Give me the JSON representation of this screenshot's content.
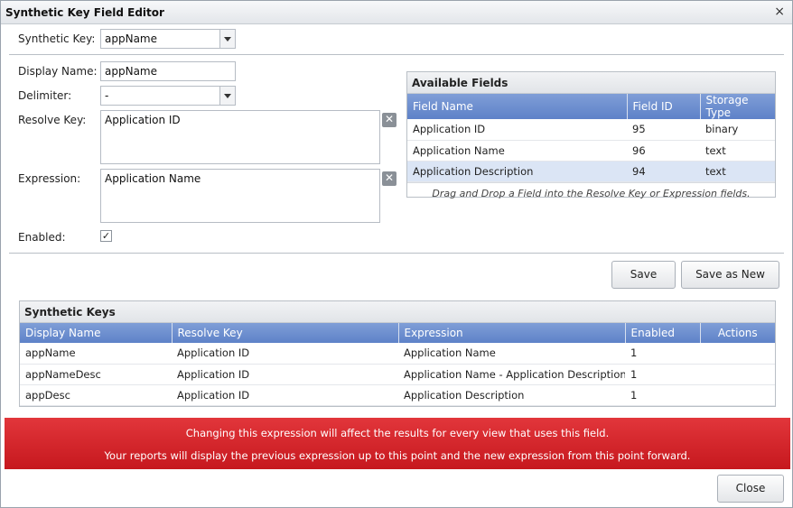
{
  "window": {
    "title": "Synthetic Key Field Editor",
    "close_glyph": "×"
  },
  "form": {
    "synthetic_key_label": "Synthetic Key:",
    "synthetic_key_value": "appName",
    "display_name_label": "Display Name:",
    "display_name_value": "appName",
    "delimiter_label": "Delimiter:",
    "delimiter_value": "-",
    "resolve_key_label": "Resolve Key:",
    "resolve_key_value": "Application ID",
    "expression_label": "Expression:",
    "expression_value": "Application Name",
    "enabled_label": "Enabled:",
    "enabled_check": "✓",
    "clear_glyph": "✕"
  },
  "available_fields": {
    "title": "Available Fields",
    "columns": [
      "Field Name",
      "Field ID",
      "Storage Type"
    ],
    "rows": [
      [
        "Application ID",
        "95",
        "binary"
      ],
      [
        "Application Name",
        "96",
        "text"
      ],
      [
        "Application Description",
        "94",
        "text"
      ]
    ],
    "hint": "Drag and Drop a Field into the Resolve Key or Expression fields."
  },
  "buttons": {
    "save": "Save",
    "save_as_new": "Save as New",
    "close": "Close"
  },
  "synthetic_keys": {
    "title": "Synthetic Keys",
    "columns": [
      "Display Name",
      "Resolve Key",
      "Expression",
      "Enabled",
      "Actions"
    ],
    "rows": [
      [
        "appName",
        "Application ID",
        "Application Name",
        "1",
        ""
      ],
      [
        "appNameDesc",
        "Application ID",
        "Application Name - Application Description",
        "1",
        ""
      ],
      [
        "appDesc",
        "Application ID",
        "Application Description",
        "1",
        ""
      ]
    ]
  },
  "warning": {
    "line1": "Changing this expression will affect the results for every view that uses this field.",
    "line2": "Your reports will display the previous expression up to this point and the new expression from this point forward."
  },
  "colors": {
    "header_blue": "#6a8ccf",
    "warning_red": "#d42a2f",
    "selected_row": "#dbe5f5"
  },
  "icons": {
    "clear": "clear-x-icon",
    "dropdown": "chevron-down-icon",
    "close": "close-icon"
  }
}
